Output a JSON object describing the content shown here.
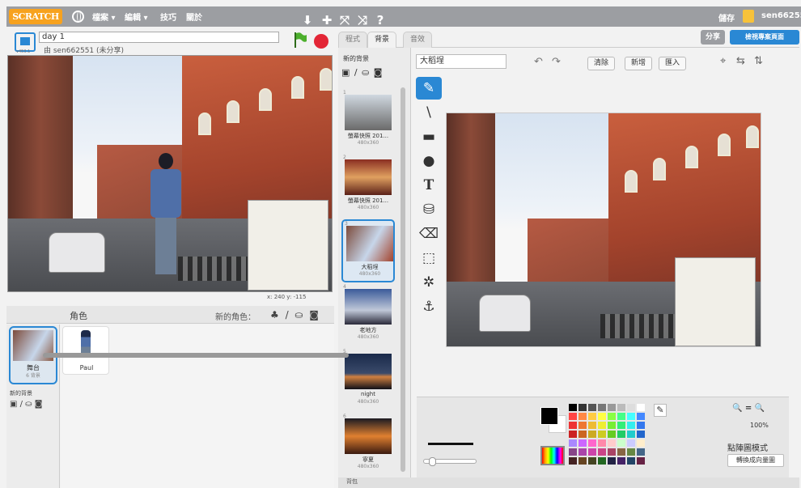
{
  "topbar": {
    "logo": "SCRATCH",
    "menus": [
      {
        "label": "檔案 ▾"
      },
      {
        "label": "編輯 ▾"
      },
      {
        "label": "技巧"
      },
      {
        "label": "關於"
      }
    ],
    "tools": [
      "⬇",
      "✚",
      "⤧",
      "⤨",
      "?"
    ],
    "save": "儲存",
    "user": "sen662551"
  },
  "stage": {
    "version": "v453.1",
    "title": "day 1",
    "author": "由 sen662551 (未分享)",
    "coords": "x: 240   y: -115"
  },
  "sprites": {
    "header": "角色",
    "new_sprite": "新的角色：",
    "icons": "♣ / ⛀ ◙",
    "stage_label": "舞台",
    "stage_sub": "6 背景",
    "new_backdrop": "新的背景",
    "bg_icons": "▣ / ⛀ ◙",
    "list": [
      {
        "name": "Paul"
      }
    ]
  },
  "tabs": [
    {
      "label": "程式"
    },
    {
      "label": "背景"
    },
    {
      "label": "音效"
    }
  ],
  "share": "分享",
  "project_page": "檢視專案頁面",
  "backdrops": {
    "header": "新的背景",
    "tools": "▣ / ⛀ ◙",
    "items": [
      {
        "num": "1",
        "name": "螢幕快照 201...",
        "size": "480x360"
      },
      {
        "num": "2",
        "name": "螢幕快照 201...",
        "size": "480x360"
      },
      {
        "num": "3",
        "name": "大稻埕",
        "size": "480x360"
      },
      {
        "num": "4",
        "name": "老地方",
        "size": "480x360"
      },
      {
        "num": "5",
        "name": "night",
        "size": "480x360"
      },
      {
        "num": "6",
        "name": "寧夏",
        "size": "480x360"
      }
    ]
  },
  "editor": {
    "costume_name": "大稻埕",
    "undo": "↶",
    "redo": "↷",
    "clear": "清除",
    "add": "新增",
    "import": "匯入",
    "top_icons": [
      "⌖",
      "⇆",
      "⇅"
    ],
    "tools": [
      "✎",
      "\\",
      "▬",
      "●",
      "T",
      "⛁",
      "⌫",
      "⬚",
      "✲",
      "⚓"
    ],
    "zoom": "🔍 = 🔍",
    "zoom_pct": "100%",
    "mode": "點陣圖模式",
    "convert": "轉換成向量圖"
  },
  "footer": "背包",
  "colors": {
    "accent": "#2a88d4",
    "topbar": "#9c9ea2",
    "logo": "#f7a21e",
    "stop": "#e32636"
  }
}
